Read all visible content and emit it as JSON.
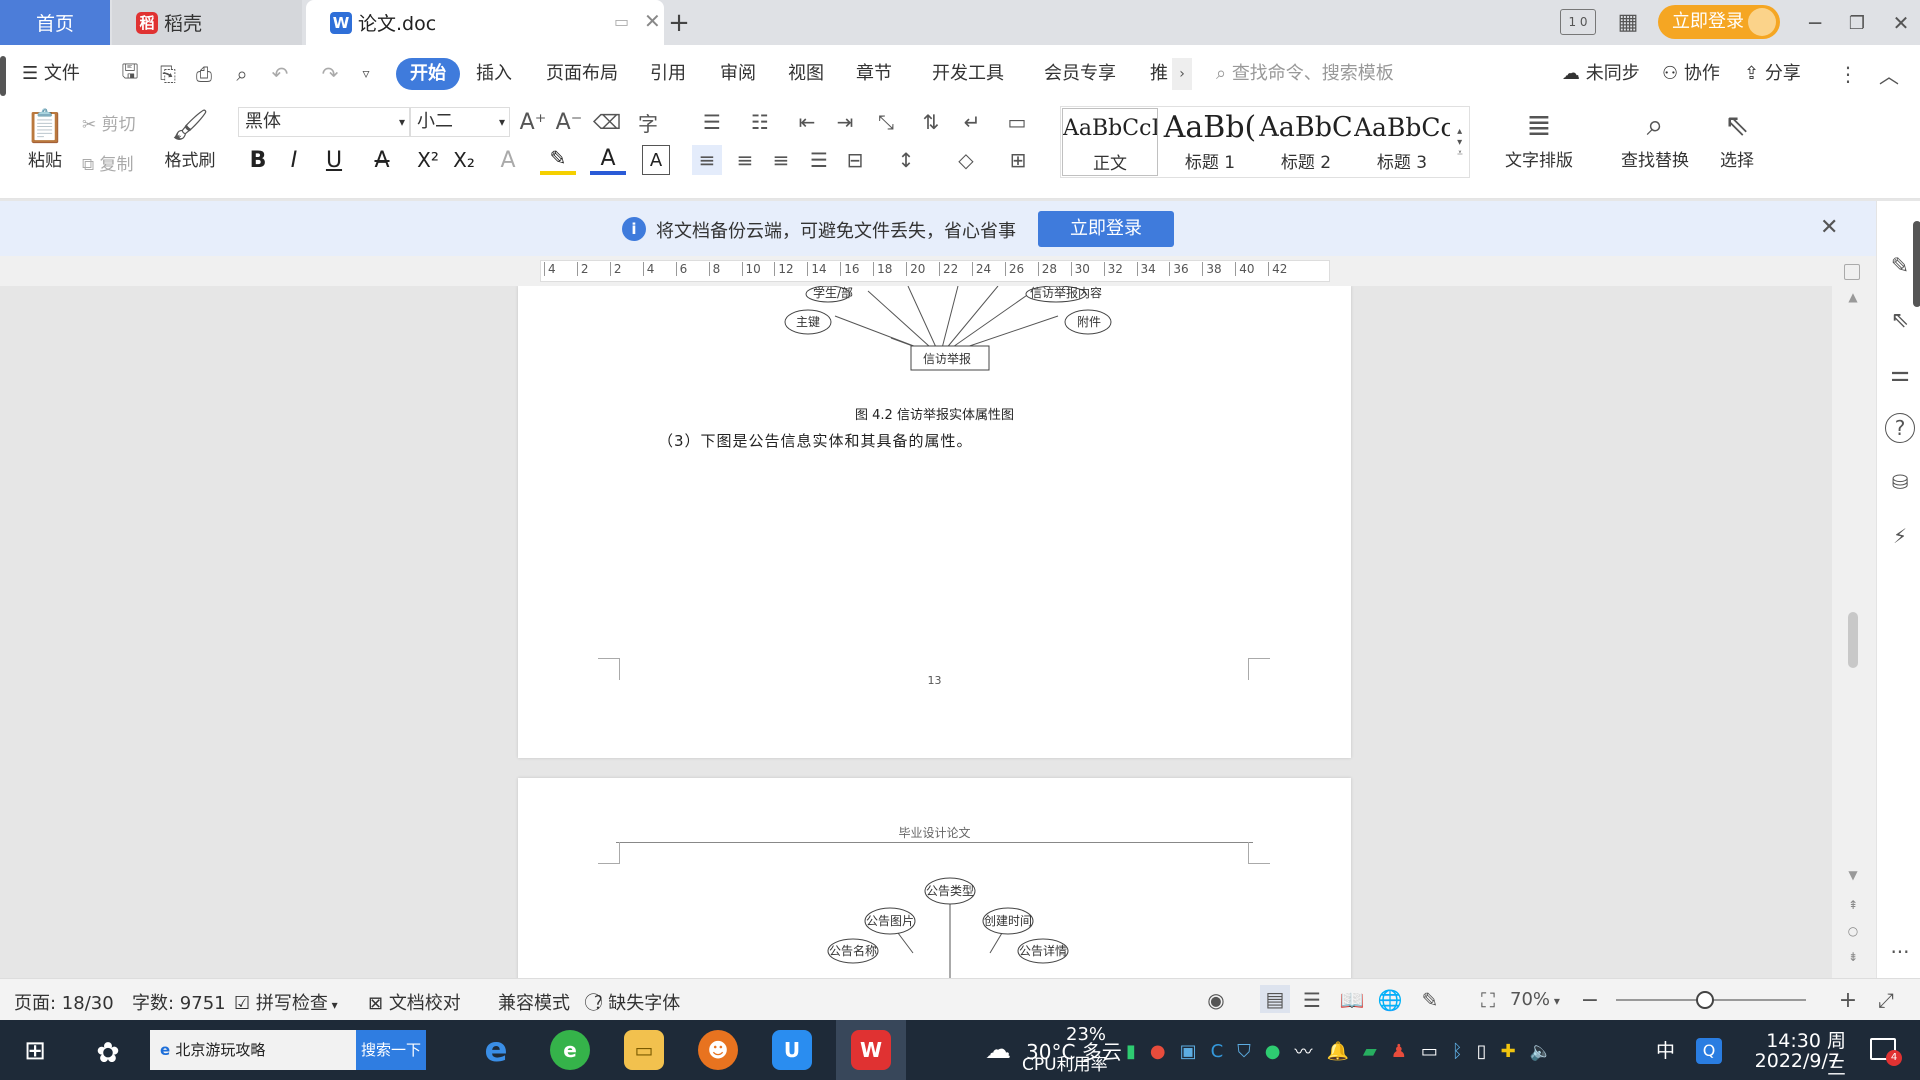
{
  "tabs": {
    "home": "首页",
    "daoke": "稻壳",
    "doc": "论文.doc"
  },
  "titlebar": {
    "login_button": "立即登录"
  },
  "menu": {
    "file": "文件",
    "items": [
      "开始",
      "插入",
      "页面布局",
      "引用",
      "审阅",
      "视图",
      "章节",
      "开发工具",
      "会员专享",
      "推"
    ],
    "search_placeholder": "查找命令、搜索模板",
    "sync": "未同步",
    "collab": "协作",
    "share": "分享"
  },
  "ribbon": {
    "paste": "粘贴",
    "cut": "剪切",
    "copy": "复制",
    "format_painter": "格式刷",
    "font_name": "黑体",
    "font_size": "小二",
    "styles": [
      {
        "sample": "AaBbCcI",
        "label": "正文"
      },
      {
        "sample": "AaBb(",
        "label": "标题 1"
      },
      {
        "sample": "AaBbC",
        "label": "标题 2"
      },
      {
        "sample": "AaBbCc",
        "label": "标题 3"
      }
    ],
    "text_layout": "文字排版",
    "find_replace": "查找替换",
    "select": "选择"
  },
  "notice": {
    "text": "将文档备份云端，可避免文件丢失，省心省事",
    "button": "立即登录"
  },
  "ruler": {
    "ticks": [
      "4",
      "2",
      "2",
      "4",
      "6",
      "8",
      "10",
      "12",
      "14",
      "16",
      "18",
      "20",
      "22",
      "24",
      "26",
      "28",
      "30",
      "32",
      "34",
      "36",
      "38",
      "40",
      "42"
    ]
  },
  "document": {
    "figure_nodes": {
      "main_key": "主键",
      "attachment": "附件",
      "entity": "信访举报",
      "partial_left": "学生/部",
      "partial_right": "信访举报内容"
    },
    "figure_caption": "图 4.2 信访举报实体属性图",
    "paragraph": "（3）下图是公告信息实体和其具备的属性。",
    "page_number": "13",
    "header_text": "毕业设计论文",
    "figure2_nodes": {
      "type": "公告类型",
      "image": "公告图片",
      "created": "创建时间",
      "name": "公告名称",
      "detail": "公告详情"
    }
  },
  "status": {
    "page": "页面: 18/30",
    "words": "字数: 9751",
    "spell": "拼写检查",
    "proof": "文档校对",
    "compat": "兼容模式",
    "missing_font": "缺失字体",
    "zoom": "70%",
    "zoom_level": 0.7
  },
  "taskbar": {
    "search_text": "北京游玩攻略",
    "search_button": "搜索一下",
    "weather": "30°C 多云",
    "cpu_percent": "23%",
    "cpu_label": "CPU利用率",
    "ime": "中",
    "time": "14:30 周三",
    "date": "2022/9/7",
    "notification_count": "4"
  },
  "colors": {
    "accent": "#3f7bdc",
    "login_orange": "#f5a623",
    "taskbar": "#1e2a38",
    "notice_bg": "#e7eefb"
  }
}
